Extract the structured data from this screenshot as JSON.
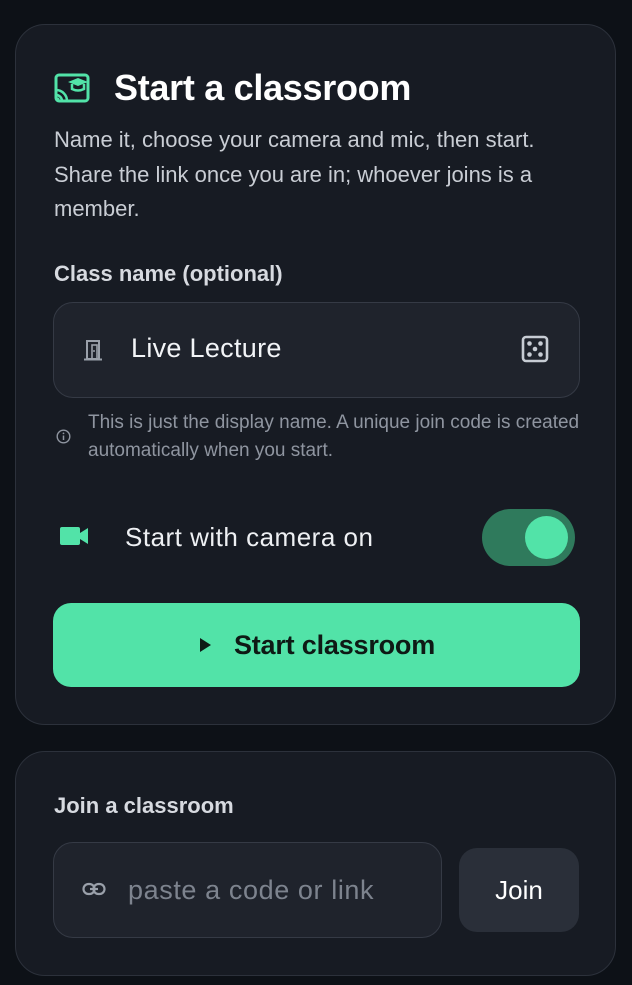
{
  "start_card": {
    "title": "Start a classroom",
    "title_icon": "cast-for-education-icon",
    "intro": "Name it, choose your camera and mic, then start. Share the link once you are in; whoever joins is a member.",
    "class_name_label": "Class name (optional)",
    "class_name_value": "Live Lecture",
    "class_name_icon": "door-icon",
    "randomize_icon": "dice-icon",
    "hint": "This is just the display name. A unique join code is created automatically when you start.",
    "hint_icon": "info-icon",
    "camera_label": "Start with camera on",
    "camera_icon": "videocam-icon",
    "camera_on": true,
    "start_button_label": "Start classroom",
    "start_button_icon": "play-icon"
  },
  "join_card": {
    "label": "Join a classroom",
    "input_icon": "link-icon",
    "input_placeholder": "paste a code or link",
    "input_value": "",
    "join_button_label": "Join"
  },
  "colors": {
    "background": "#0d1117",
    "card": "#171b23",
    "accent": "#52e3a8",
    "toggle_track": "#2f7a5c",
    "secondary_button": "#2a2f39"
  }
}
